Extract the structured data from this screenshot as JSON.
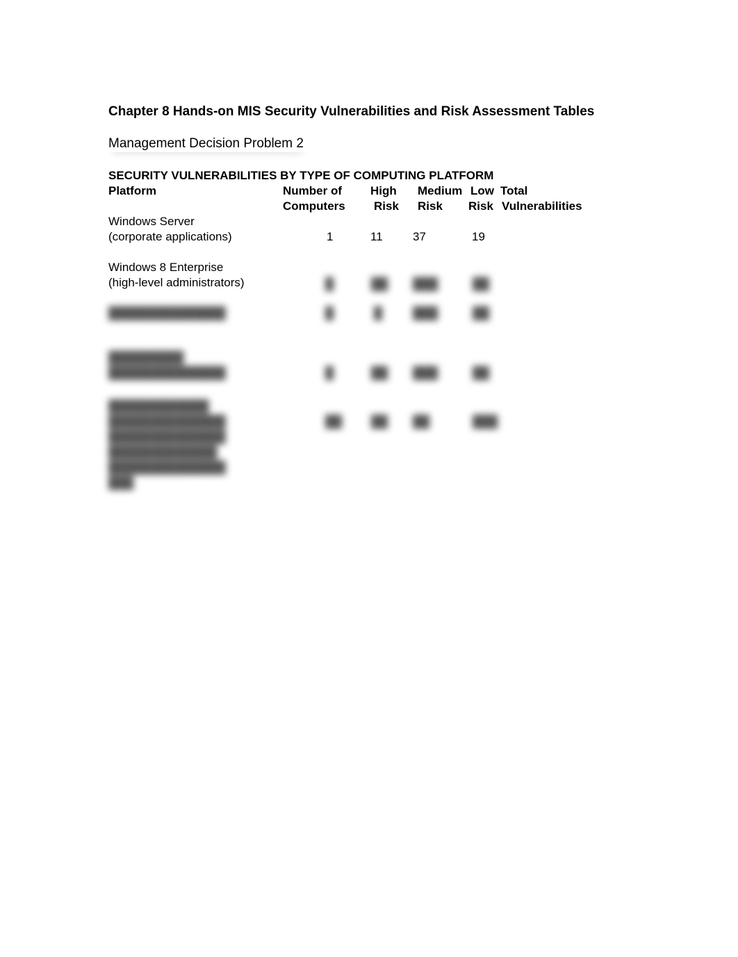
{
  "document": {
    "title": "Chapter 8 Hands-on MIS Security Vulnerabilities and Risk Assessment Tables",
    "subtitle": "Management Decision Problem 2",
    "section_heading": "SECURITY VULNERABILITIES BY TYPE OF COMPUTING PLATFORM"
  },
  "table": {
    "headers": {
      "platform": "Platform",
      "num_line1": "Number of",
      "num_line2": "Computers",
      "high_line1": "High",
      "high_line2": "Risk",
      "medium_line1": "Medium",
      "medium_line2": "Risk",
      "low_line1": "Low",
      "low_line2": "Risk",
      "total_line1": "Total",
      "total_line2": "Vulnerabilities"
    },
    "rows": [
      {
        "platform_line1": "Windows Server",
        "platform_line2": "(corporate applications)",
        "computers": "1",
        "high": "11",
        "medium": "37",
        "low": "19",
        "total": ""
      },
      {
        "platform_line1": "Windows 8 Enterprise",
        "platform_line2": "(high-level administrators)",
        "computers": "",
        "high": "",
        "medium": "",
        "low": "",
        "total": "",
        "blurred_values": true
      }
    ],
    "blurred_rows_note": "Additional rows obscured (blurred) in source"
  }
}
